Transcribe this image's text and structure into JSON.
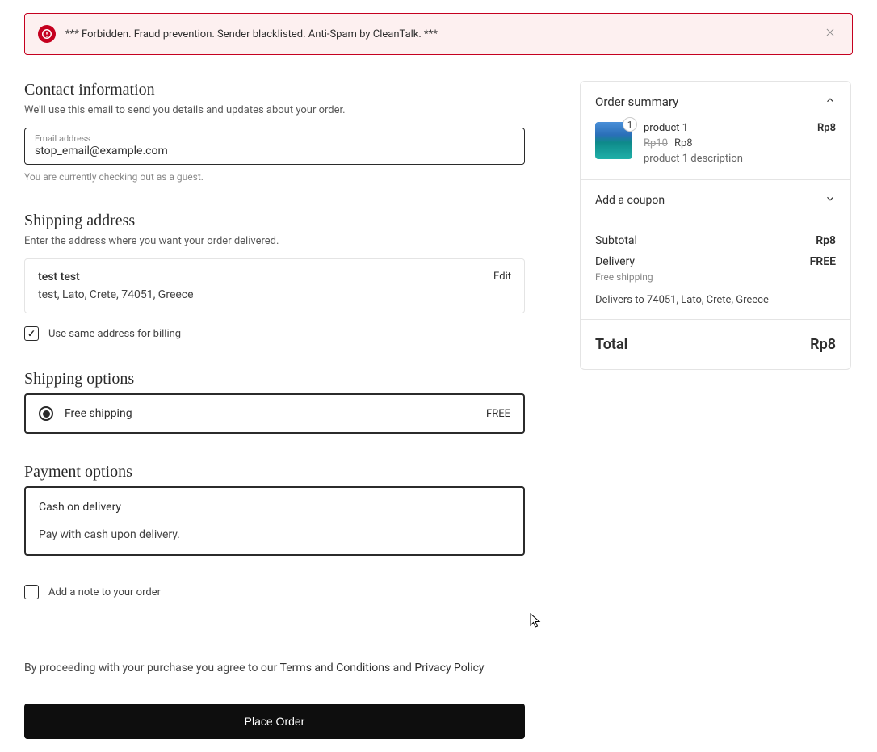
{
  "alert": {
    "message": "*** Forbidden. Fraud prevention. Sender blacklisted. Anti-Spam by CleanTalk. ***"
  },
  "contact": {
    "title": "Contact information",
    "subtitle": "We'll use this email to send you details and updates about your order.",
    "email_label": "Email address",
    "email_value": "stop_email@example.com",
    "guest_note": "You are currently checking out as a guest."
  },
  "shipping": {
    "title": "Shipping address",
    "subtitle": "Enter the address where you want your order delivered.",
    "name": "test test",
    "address_line": "test, Lato, Crete, 74051, Greece",
    "edit_label": "Edit",
    "same_billing_label": "Use same address for billing"
  },
  "shipping_options": {
    "title": "Shipping options",
    "option_label": "Free shipping",
    "option_price": "FREE"
  },
  "payment": {
    "title": "Payment options",
    "method_title": "Cash on delivery",
    "method_desc": "Pay with cash upon delivery."
  },
  "note": {
    "label": "Add a note to your order"
  },
  "legal": {
    "prefix": "By proceeding with your purchase you agree to our ",
    "terms": "Terms and Conditions",
    "and": " and ",
    "privacy": "Privacy Policy"
  },
  "place_order": "Place Order",
  "summary": {
    "title": "Order summary",
    "item": {
      "qty": "1",
      "name": "product 1",
      "price": "Rp8",
      "old_price": "Rp10",
      "new_price": "Rp8",
      "description": "product 1 description"
    },
    "coupon_label": "Add a coupon",
    "subtotal_label": "Subtotal",
    "subtotal_value": "Rp8",
    "delivery_label": "Delivery",
    "delivery_value": "FREE",
    "delivery_note": "Free shipping",
    "delivers_to": "Delivers to 74051, Lato, Crete, Greece",
    "total_label": "Total",
    "total_value": "Rp8"
  }
}
